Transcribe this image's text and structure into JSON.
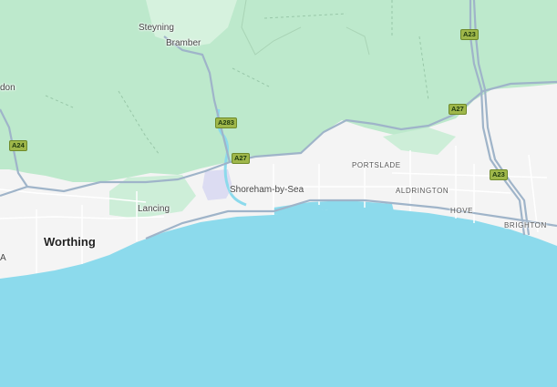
{
  "map": {
    "colors": {
      "sea": "#8cdaec",
      "land": "#f4f4f4",
      "park": "#bde9cc",
      "motorway": "#9fb4c9",
      "road_shield": "#9fb74a"
    },
    "places": {
      "steyning": "Steyning",
      "bramber": "Bramber",
      "don_partial": "don",
      "lancing": "Lancing",
      "worthing": "Worthing",
      "shoreham": "Shoreham-by-Sea",
      "portslade": "PORTSLADE",
      "aldrington": "ALDRINGTON",
      "hove": "HOVE",
      "brighton": "BRIGHTON",
      "a_partial": "A"
    },
    "roads": {
      "a24": "A24",
      "a283": "A283",
      "a27_west": "A27",
      "a27_east": "A27",
      "a23_north": "A23",
      "a23_south": "A23"
    },
    "icons": {
      "airport": "airport-area"
    }
  }
}
